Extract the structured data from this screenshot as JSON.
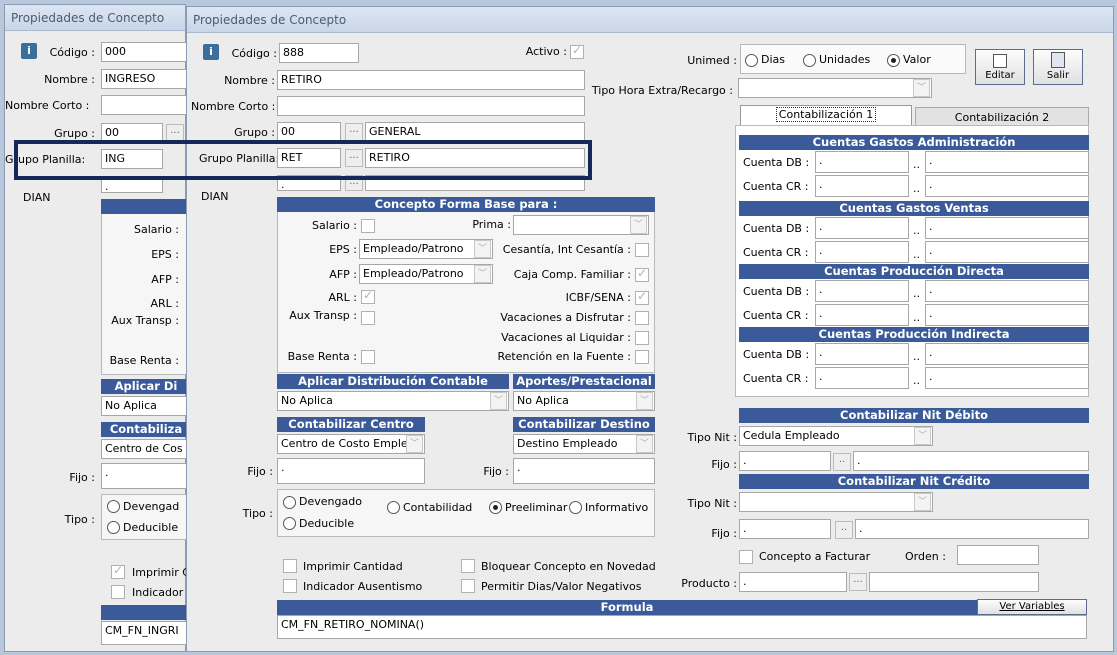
{
  "back": {
    "title": "Propiedades de Concepto",
    "codigo_label": "Código :",
    "codigo": "000",
    "nombre_label": "Nombre :",
    "nombre": "INGRESO",
    "nombre_corto_label": "Nombre Corto :",
    "grupo_label": "Grupo :",
    "grupo": "00",
    "grupo_planilla_label": "Grupo Planilla:",
    "grupo_planilla": "ING",
    "dian_label": "DIAN",
    "dian_value": ".",
    "salario": "Salario :",
    "eps": "EPS :",
    "afp": "AFP :",
    "arl": "ARL :",
    "aux": "Aux Transp :",
    "base_renta": "Base Renta :",
    "aplicar": "Aplicar Di",
    "no_aplica": "No Aplica",
    "contabiliza": "Contabiliza",
    "centro": "Centro de Cos",
    "fijo_label": "Fijo :",
    "fijo": ".",
    "tipo_label": "Tipo :",
    "devengado": "Devengad",
    "deducible": "Deducible",
    "imprimir": "Imprimir C",
    "indicador": "Indicador",
    "formula": "CM_FN_INGRI"
  },
  "front": {
    "title": "Propiedades de Concepto",
    "codigo_label": "Código :",
    "codigo": "888",
    "activo_label": "Activo :",
    "nombre_label": "Nombre :",
    "nombre": "RETIRO",
    "nombre_corto_label": "Nombre Corto :",
    "grupo_label": "Grupo :",
    "grupo": "00",
    "grupo_desc": "GENERAL",
    "grupo_planilla_label": "Grupo Planilla:",
    "grupo_planilla": "RET",
    "grupo_planilla_desc": "RETIRO",
    "dian_label": "DIAN",
    "dian_value": ".",
    "forma_base_header": "Concepto Forma Base para :",
    "salario_label": "Salario :",
    "prima_label": "Prima :",
    "eps_label": "EPS :",
    "eps_value": "Empleado/Patrono",
    "cesantia_label": "Cesantía, Int Cesantía :",
    "afp_label": "AFP :",
    "afp_value": "Empleado/Patrono",
    "caja_label": "Caja Comp. Familiar :",
    "arl_label": "ARL :",
    "icbf_label": "ICBF/SENA :",
    "aux_label": "Aux Transp :",
    "vac_disfrutar_label": "Vacaciones a Disfrutar :",
    "vac_liquidar_label": "Vacaciones al Liquidar :",
    "base_renta_label": "Base Renta :",
    "retencion_label": "Retención en la Fuente :",
    "aplicar_header": "Aplicar Distribución Contable",
    "aplicar_value": "No Aplica",
    "aportes_header": "Aportes/Prestacional",
    "aportes_value": "No Aplica",
    "centro_header": "Contabilizar Centro",
    "centro_value": "Centro de Costo Emple",
    "destino_header": "Contabilizar Destino",
    "destino_value": "Destino Empleado",
    "fijo_label": "Fijo :",
    "fijo_value": ".",
    "fijo2_label": "Fijo :",
    "fijo2_value": ".",
    "tipo_label": "Tipo :",
    "devengado": "Devengado",
    "deducible": "Deducible",
    "contabilidad": "Contabilidad",
    "preeliminar": "Preeliminar",
    "informativo": "Informativo",
    "imprimir": "Imprimir Cantidad",
    "bloquear": "Bloquear Concepto en Novedad",
    "indicador": "Indicador Ausentismo",
    "permitir": "Permitir Dias/Valor Negativos",
    "formula_header": "Formula",
    "ver_variables": "Ver Variables",
    "formula_value": "CM_FN_RETIRO_NOMINA()",
    "unimed_label": "Unimed :",
    "dias": "Dias",
    "unidades": "Unidades",
    "valor": "Valor",
    "editar": "Editar",
    "salir": "Salir",
    "tipo_hora_label": "Tipo Hora Extra/Recargo :",
    "tab1": "Contabilización 1",
    "tab2": "Contabilización 2",
    "cga_header": "Cuentas Gastos Administración",
    "cgv_header": "Cuentas Gastos Ventas",
    "cpd_header": "Cuentas Producción Directa",
    "cpi_header": "Cuentas Producción Indirecta",
    "cuenta_db": "Cuenta DB :",
    "cuenta_cr": "Cuenta CR :",
    "dot": ".",
    "dots2": "..",
    "nit_debito_header": "Contabilizar Nit Débito",
    "tipo_nit_label": "Tipo Nit :",
    "tipo_nit_value": "Cedula Empleado",
    "nit_fijo_label": "Fijo :",
    "nit_fijo_value": ".",
    "nit_credito_header": "Contabilizar Nit Crédito",
    "tipo_nit2_label": "Tipo Nit :",
    "fijo3_label": "Fijo :",
    "fijo3_value": ".",
    "facturar": "Concepto a Facturar",
    "orden_label": "Orden :",
    "producto_label": "Producto :",
    "producto_value": "."
  },
  "colors": {
    "header": "#3b5a9a",
    "highlight": "#15285a"
  }
}
